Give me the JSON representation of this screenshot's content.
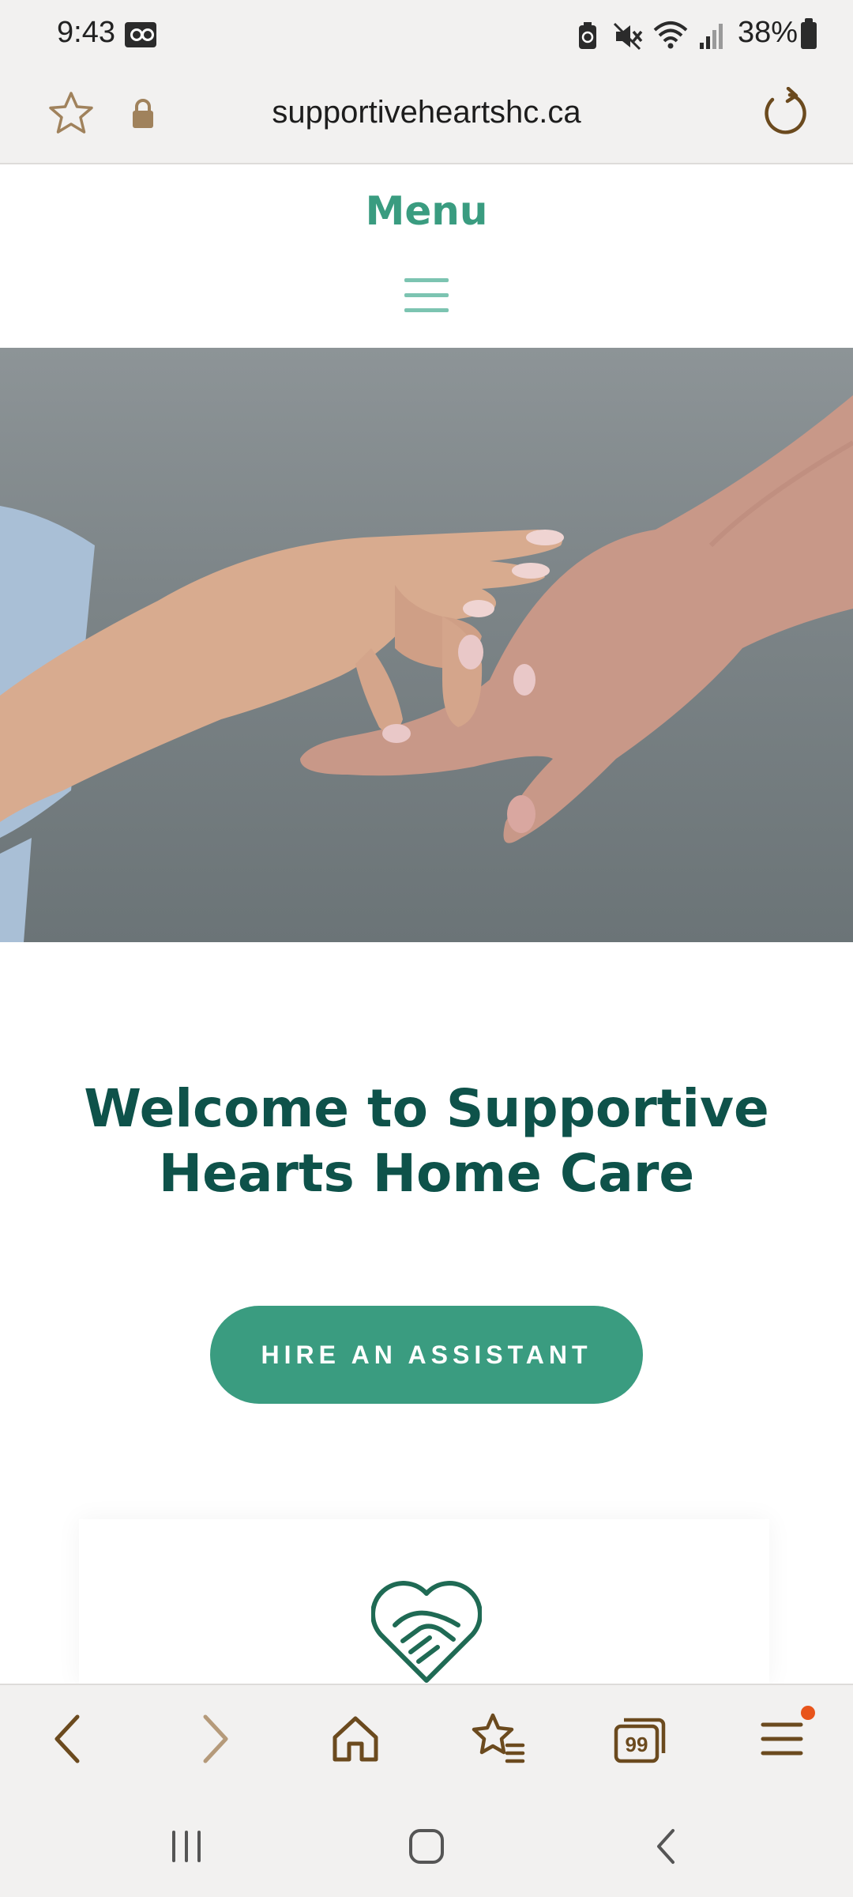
{
  "status_bar": {
    "time": "9:43",
    "battery_percent": "38%",
    "icons": [
      "voicemail-icon",
      "battery-saver-icon",
      "mute-icon",
      "wifi-icon",
      "signal-icon",
      "battery-icon"
    ]
  },
  "browser": {
    "url": "supportiveheartshc.ca",
    "icons": [
      "star-icon",
      "lock-icon",
      "reload-icon"
    ],
    "accent_color": "#6b4a1e"
  },
  "site": {
    "menu_label": "Menu",
    "hero_image": "hands-holding-photo",
    "welcome_title": "Welcome to Supportive Hearts Home Care",
    "cta_label": "HIRE AN ASSISTANT",
    "brand_color": "#3a9c80",
    "title_color": "#0e524a"
  },
  "bottom_nav": {
    "items": [
      "back-icon",
      "forward-icon",
      "home-icon",
      "bookmarks-icon",
      "tabs-icon",
      "menu-icon"
    ],
    "tabs_count": "99"
  },
  "system_nav": {
    "items": [
      "recents-icon",
      "home-icon",
      "back-icon"
    ]
  }
}
